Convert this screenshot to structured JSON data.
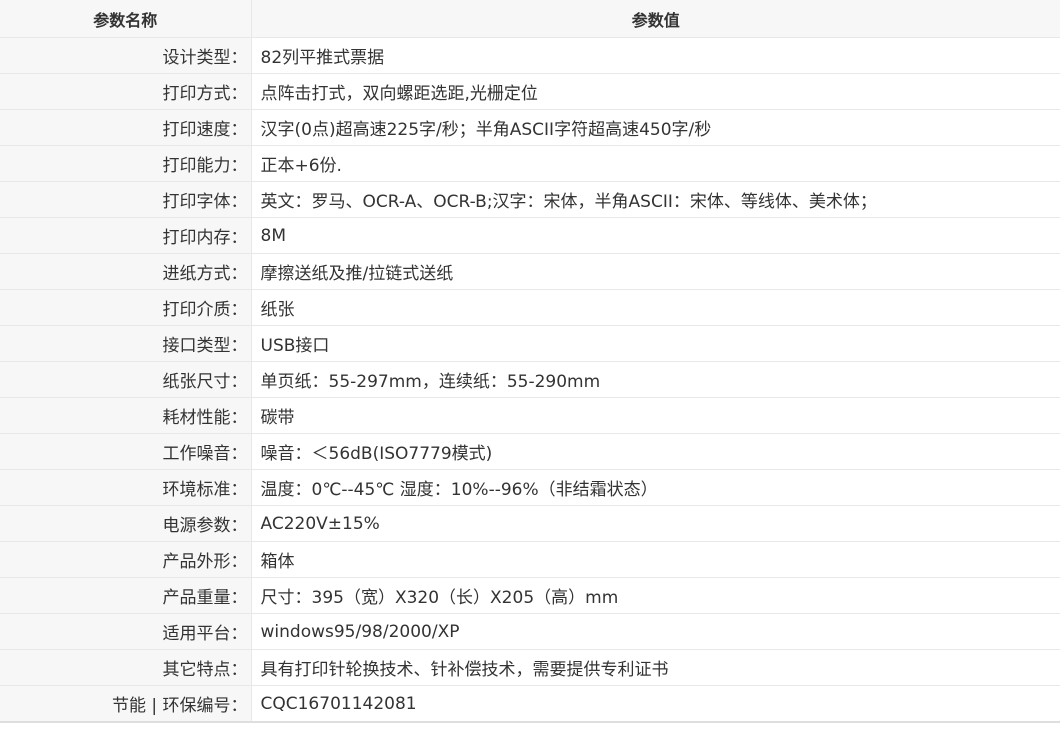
{
  "table": {
    "headers": [
      "参数名称",
      "参数值"
    ],
    "rows": [
      {
        "name": "设计类型：",
        "value": "82列平推式票据"
      },
      {
        "name": "打印方式：",
        "value": "点阵击打式，双向螺距选距,光栅定位"
      },
      {
        "name": "打印速度：",
        "value": "汉字(0点)超高速225字/秒；半角ASCII字符超高速450字/秒"
      },
      {
        "name": "打印能力：",
        "value": "正本+6份."
      },
      {
        "name": "打印字体：",
        "value": "英文：罗马、OCR-A、OCR-B;汉字：宋体，半角ASCII：宋体、等线体、美术体；"
      },
      {
        "name": "打印内存：",
        "value": "8M"
      },
      {
        "name": "进纸方式：",
        "value": "摩擦送纸及推/拉链式送纸"
      },
      {
        "name": "打印介质：",
        "value": "纸张"
      },
      {
        "name": "接口类型：",
        "value": "USB接口"
      },
      {
        "name": "纸张尺寸：",
        "value": "单页纸：55-297mm，连续纸：55-290mm"
      },
      {
        "name": "耗材性能：",
        "value": "碳带"
      },
      {
        "name": "工作噪音：",
        "value": "噪音：＜56dB(ISO7779模式)"
      },
      {
        "name": "环境标准：",
        "value": "温度：0℃--45℃ 湿度：10%--96%（非结霜状态）"
      },
      {
        "name": "电源参数：",
        "value": "AC220V±15%"
      },
      {
        "name": "产品外形：",
        "value": "箱体"
      },
      {
        "name": "产品重量：",
        "value": "尺寸：395（宽）X320（长）X205（高）mm"
      },
      {
        "name": "适用平台：",
        "value": "windows95/98/2000/XP"
      },
      {
        "name": "其它特点：",
        "value": "具有打印针轮换技术、针补偿技术，需要提供专利证书"
      },
      {
        "name": "节能 | 环保编号：",
        "value": "CQC16701142081"
      }
    ]
  }
}
